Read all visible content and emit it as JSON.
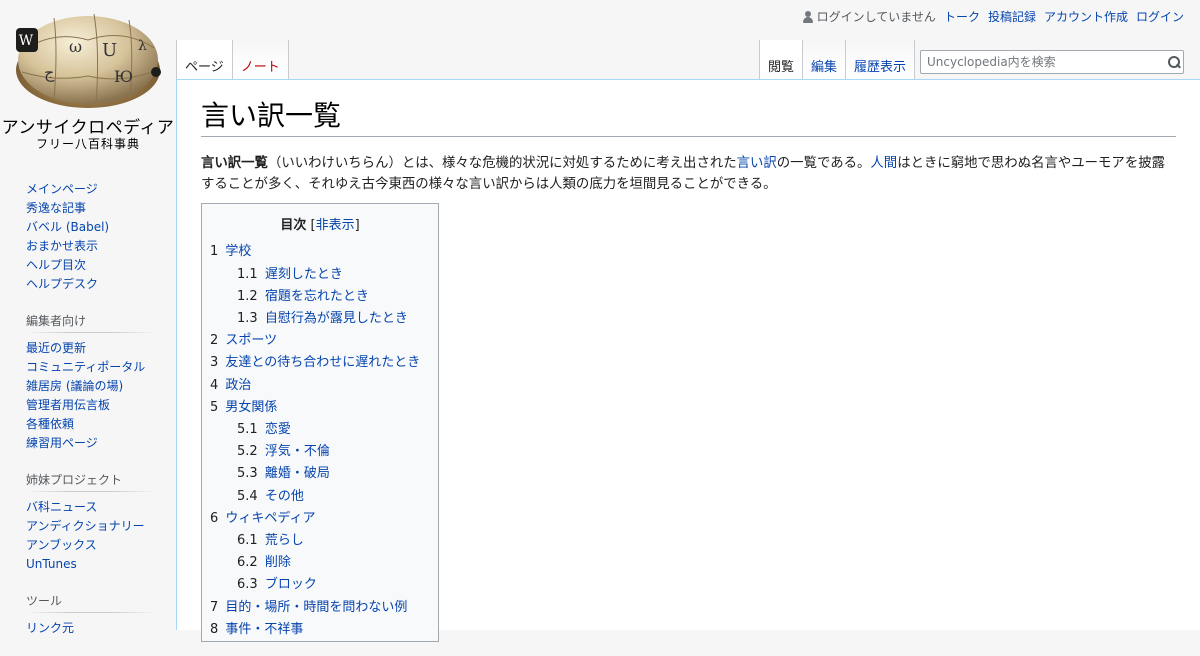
{
  "personal": {
    "not_logged_in": "ログインしていません",
    "links": [
      "トーク",
      "投稿記録",
      "アカウント作成",
      "ログイン"
    ]
  },
  "logo": {
    "title": "アンサイクロペディア",
    "subtitle": "フリー八百科事典"
  },
  "tabs": {
    "left": [
      {
        "label": "ページ",
        "selected": true
      },
      {
        "label": "ノート",
        "new": true
      }
    ],
    "right": [
      {
        "label": "閲覧",
        "selected": true
      },
      {
        "label": "編集"
      },
      {
        "label": "履歴表示"
      }
    ]
  },
  "search": {
    "placeholder": "Uncyclopedia内を検索"
  },
  "sidebar": {
    "navigation": [
      "メインページ",
      "秀逸な記事",
      "バベル (Babel)",
      "おまかせ表示",
      "ヘルプ目次",
      "ヘルプデスク"
    ],
    "editors": {
      "heading": "編集者向け",
      "items": [
        "最近の更新",
        "コミュニティポータル",
        "雑居房 (議論の場)",
        "管理者用伝言板",
        "各種依頼",
        "練習用ページ"
      ]
    },
    "sister": {
      "heading": "姉妹プロジェクト",
      "items": [
        "バ科ニュース",
        "アンディクショナリー",
        "アンブックス",
        "UnTunes"
      ]
    },
    "tools": {
      "heading": "ツール",
      "items": [
        "リンク元"
      ]
    }
  },
  "article": {
    "title": "言い訳一覧",
    "lead": {
      "bold": "言い訳一覧",
      "part1": "（いいわけいちらん）とは、様々な危機的状況に対処するために考え出された",
      "link1": "言い訳",
      "part2": "の一覧である。",
      "link2": "人間",
      "part3": "はときに窮地で思わぬ名言やユーモアを披露することが多く、それゆえ古今東西の様々な言い訳からは人類の底力を垣間見ることができる。"
    }
  },
  "toc": {
    "title": "目次",
    "toggle": "非表示",
    "items": [
      {
        "number": "1",
        "text": "学校",
        "level": 1
      },
      {
        "number": "1.1",
        "text": "遅刻したとき",
        "level": 2
      },
      {
        "number": "1.2",
        "text": "宿題を忘れたとき",
        "level": 2
      },
      {
        "number": "1.3",
        "text": "自慰行為が露見したとき",
        "level": 2
      },
      {
        "number": "2",
        "text": "スポーツ",
        "level": 1
      },
      {
        "number": "3",
        "text": "友達との待ち合わせに遅れたとき",
        "level": 1
      },
      {
        "number": "4",
        "text": "政治",
        "level": 1
      },
      {
        "number": "5",
        "text": "男女関係",
        "level": 1
      },
      {
        "number": "5.1",
        "text": "恋愛",
        "level": 2
      },
      {
        "number": "5.2",
        "text": "浮気・不倫",
        "level": 2
      },
      {
        "number": "5.3",
        "text": "離婚・破局",
        "level": 2
      },
      {
        "number": "5.4",
        "text": "その他",
        "level": 2
      },
      {
        "number": "6",
        "text": "ウィキペディア",
        "level": 1
      },
      {
        "number": "6.1",
        "text": "荒らし",
        "level": 2
      },
      {
        "number": "6.2",
        "text": "削除",
        "level": 2
      },
      {
        "number": "6.3",
        "text": "ブロック",
        "level": 2
      },
      {
        "number": "7",
        "text": "目的・場所・時間を問わない例",
        "level": 1
      },
      {
        "number": "8",
        "text": "事件・不祥事",
        "level": 1
      }
    ]
  }
}
